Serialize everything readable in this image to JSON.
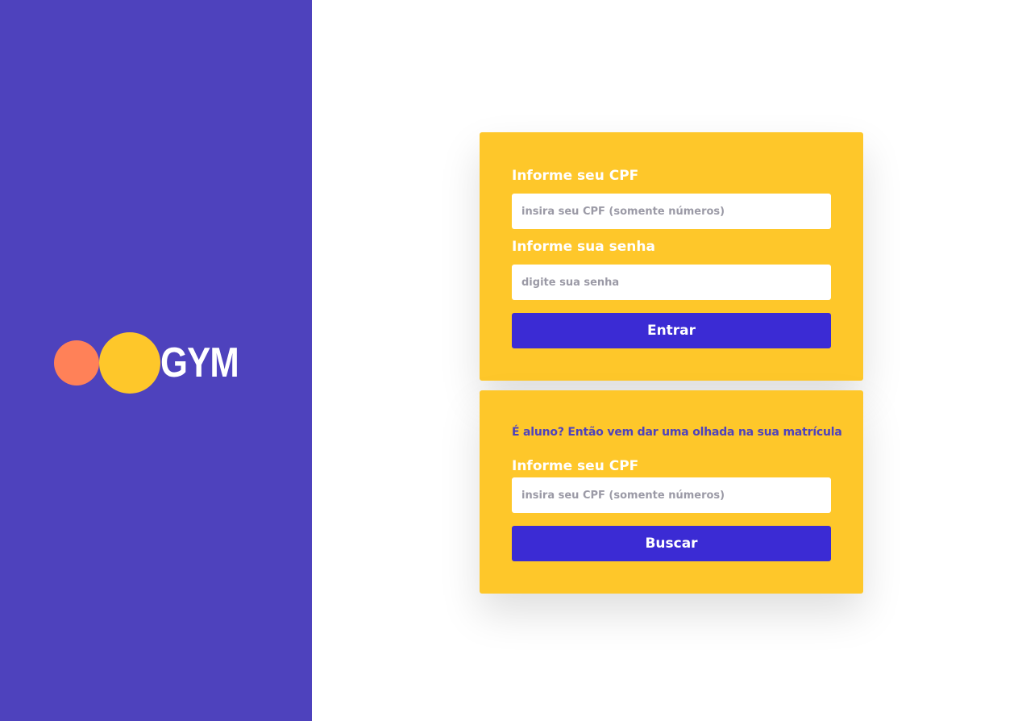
{
  "brand": {
    "logo_text": "GYM",
    "colors": {
      "sidebar": "#4e42bd",
      "accent_yellow": "#fec72a",
      "accent_orange": "#ff8158",
      "button": "#3b2bd4"
    }
  },
  "login_card": {
    "cpf_label": "Informe seu CPF",
    "cpf_placeholder": "insira seu CPF (somente números)",
    "password_label": "Informe sua senha",
    "password_placeholder": "digite sua senha",
    "submit_label": "Entrar"
  },
  "search_card": {
    "subtitle": "É aluno? Então vem dar uma olhada na sua matrícula",
    "cpf_label": "Informe seu CPF",
    "cpf_placeholder": "insira seu CPF (somente números)",
    "submit_label": "Buscar"
  }
}
